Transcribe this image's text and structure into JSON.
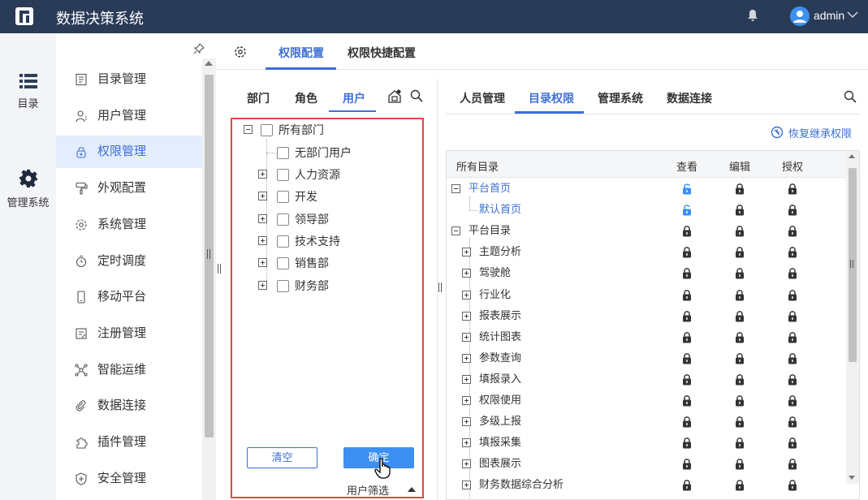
{
  "app": {
    "title": "数据决策系统",
    "user": "admin"
  },
  "rail": [
    {
      "label": "目录",
      "icon": "list-icon"
    },
    {
      "label": "管理系统",
      "icon": "gear-icon"
    }
  ],
  "menu": [
    {
      "label": "目录管理",
      "icon": "catalog-icon",
      "active": false
    },
    {
      "label": "用户管理",
      "icon": "user-icon",
      "active": false
    },
    {
      "label": "权限管理",
      "icon": "lock-icon",
      "active": true
    },
    {
      "label": "外观配置",
      "icon": "paint-roller-icon",
      "active": false
    },
    {
      "label": "系统管理",
      "icon": "cog-icon",
      "active": false
    },
    {
      "label": "定时调度",
      "icon": "timer-icon",
      "active": false
    },
    {
      "label": "移动平台",
      "icon": "mobile-icon",
      "active": false
    },
    {
      "label": "注册管理",
      "icon": "register-icon",
      "active": false
    },
    {
      "label": "智能运维",
      "icon": "ops-icon",
      "active": false
    },
    {
      "label": "数据连接",
      "icon": "link-icon",
      "active": false
    },
    {
      "label": "插件管理",
      "icon": "plugin-icon",
      "active": false
    },
    {
      "label": "安全管理",
      "icon": "shield-icon",
      "active": false
    }
  ],
  "main_tabs": [
    "权限配置",
    "权限快捷配置"
  ],
  "left_panel": {
    "tabs": [
      "部门",
      "角色",
      "用户"
    ],
    "tree": {
      "root": "所有部门",
      "no_dept": "无部门用户",
      "children": [
        "人力资源",
        "开发",
        "领导部",
        "技术支持",
        "销售部",
        "财务部"
      ]
    },
    "clear_label": "清空",
    "ok_label": "确定",
    "filter_label": "用户筛选"
  },
  "right_panel": {
    "tabs": [
      "人员管理",
      "目录权限",
      "管理系统",
      "数据连接"
    ],
    "restore_label": "恢复继承权限",
    "columns": [
      "所有目录",
      "查看",
      "编辑",
      "授权"
    ],
    "rows": [
      {
        "label": "平台首页",
        "level": 0,
        "expander": "minus",
        "link": true,
        "view": "unlocked"
      },
      {
        "label": "默认首页",
        "level": 1,
        "expander": "none",
        "link": true,
        "view": "unlocked"
      },
      {
        "label": "平台目录",
        "level": 0,
        "expander": "minus",
        "link": false,
        "view": "locked"
      },
      {
        "label": "主题分析",
        "level": 1,
        "expander": "plus",
        "link": false,
        "view": "locked"
      },
      {
        "label": "驾驶舱",
        "level": 1,
        "expander": "plus",
        "link": false,
        "view": "locked"
      },
      {
        "label": "行业化",
        "level": 1,
        "expander": "plus",
        "link": false,
        "view": "locked"
      },
      {
        "label": "报表展示",
        "level": 1,
        "expander": "plus",
        "link": false,
        "view": "locked"
      },
      {
        "label": "统计图表",
        "level": 1,
        "expander": "plus",
        "link": false,
        "view": "locked"
      },
      {
        "label": "参数查询",
        "level": 1,
        "expander": "plus",
        "link": false,
        "view": "locked"
      },
      {
        "label": "填报录入",
        "level": 1,
        "expander": "plus",
        "link": false,
        "view": "locked"
      },
      {
        "label": "权限使用",
        "level": 1,
        "expander": "plus",
        "link": false,
        "view": "locked"
      },
      {
        "label": "多级上报",
        "level": 1,
        "expander": "plus",
        "link": false,
        "view": "locked"
      },
      {
        "label": "填报采集",
        "level": 1,
        "expander": "plus",
        "link": false,
        "view": "locked"
      },
      {
        "label": "图表展示",
        "level": 1,
        "expander": "plus",
        "link": false,
        "view": "locked"
      },
      {
        "label": "财务数据综合分析",
        "level": 1,
        "expander": "plus",
        "link": false,
        "view": "locked"
      }
    ]
  },
  "colors": {
    "accent": "#3d6fd6",
    "topbar": "#2a3b57",
    "highlight_border": "#e64545",
    "unlocked": "#3d8ff1",
    "locked": "#333333"
  }
}
